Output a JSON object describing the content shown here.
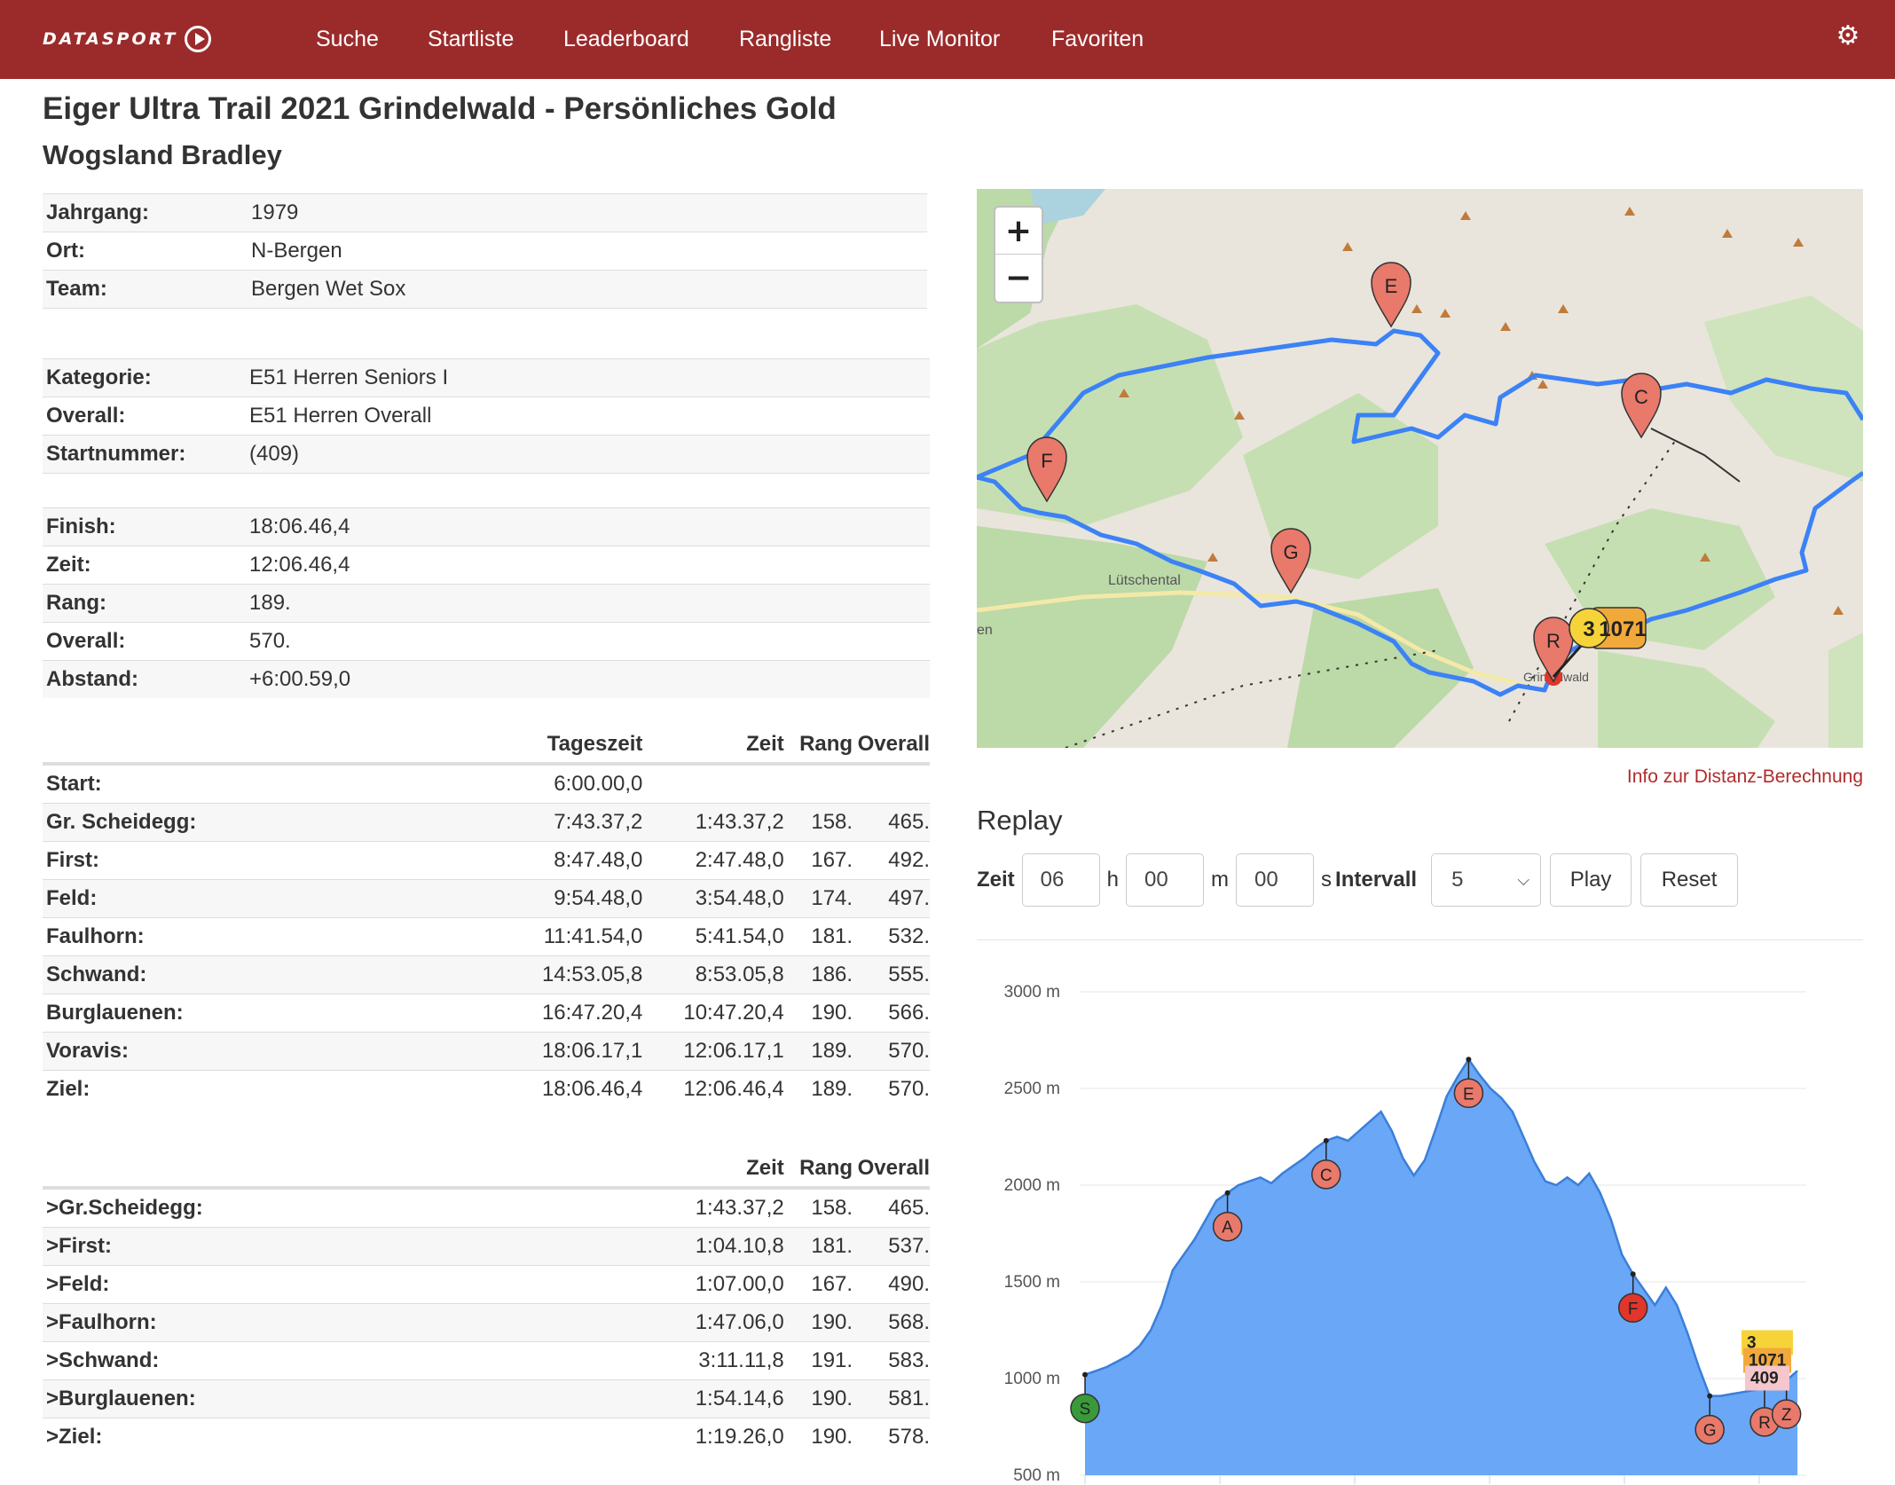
{
  "nav": {
    "brand": "DATASPORT",
    "items": [
      "Suche",
      "Startliste",
      "Leaderboard",
      "Rangliste",
      "Live Monitor",
      "Favoriten"
    ],
    "settings_icon": "gear-icon"
  },
  "title": "Eiger Ultra Trail 2021 Grindelwald - Persönliches Gold",
  "athlete": "Wogsland Bradley",
  "personal": [
    {
      "k": "Jahrgang:",
      "v": "1979"
    },
    {
      "k": "Ort:",
      "v": "N-Bergen"
    },
    {
      "k": "Team:",
      "v": "Bergen Wet Sox"
    }
  ],
  "category": [
    {
      "k": "Kategorie:",
      "v": "E51 Herren Seniors I"
    },
    {
      "k": "Overall:",
      "v": "E51 Herren Overall"
    },
    {
      "k": "Startnummer:",
      "v": "(409)"
    }
  ],
  "result": [
    {
      "k": "Finish:",
      "v": "18:06.46,4"
    },
    {
      "k": "Zeit:",
      "v": "12:06.46,4"
    },
    {
      "k": "Rang:",
      "v": "189."
    },
    {
      "k": "Overall:",
      "v": "570."
    },
    {
      "k": "Abstand:",
      "v": "+6:00.59,0"
    }
  ],
  "splits": {
    "headers": {
      "tageszeit": "Tageszeit",
      "zeit": "Zeit",
      "rang": "Rang",
      "overall": "Overall"
    },
    "rows": [
      {
        "name": "Start:",
        "tag": "6:00.00,0",
        "zeit": "",
        "rang": "",
        "overall": ""
      },
      {
        "name": "Gr. Scheidegg:",
        "tag": "7:43.37,2",
        "zeit": "1:43.37,2",
        "rang": "158.",
        "overall": "465."
      },
      {
        "name": "First:",
        "tag": "8:47.48,0",
        "zeit": "2:47.48,0",
        "rang": "167.",
        "overall": "492."
      },
      {
        "name": "Feld:",
        "tag": "9:54.48,0",
        "zeit": "3:54.48,0",
        "rang": "174.",
        "overall": "497."
      },
      {
        "name": "Faulhorn:",
        "tag": "11:41.54,0",
        "zeit": "5:41.54,0",
        "rang": "181.",
        "overall": "532."
      },
      {
        "name": "Schwand:",
        "tag": "14:53.05,8",
        "zeit": "8:53.05,8",
        "rang": "186.",
        "overall": "555."
      },
      {
        "name": "Burglauenen:",
        "tag": "16:47.20,4",
        "zeit": "10:47.20,4",
        "rang": "190.",
        "overall": "566."
      },
      {
        "name": "Voravis:",
        "tag": "18:06.17,1",
        "zeit": "12:06.17,1",
        "rang": "189.",
        "overall": "570."
      },
      {
        "name": "Ziel:",
        "tag": "18:06.46,4",
        "zeit": "12:06.46,4",
        "rang": "189.",
        "overall": "570."
      }
    ]
  },
  "segments": {
    "headers": {
      "zeit": "Zeit",
      "rang": "Rang",
      "overall": "Overall"
    },
    "rows": [
      {
        "name": ">Gr.Scheidegg:",
        "zeit": "1:43.37,2",
        "rang": "158.",
        "overall": "465."
      },
      {
        "name": ">First:",
        "zeit": "1:04.10,8",
        "rang": "181.",
        "overall": "537."
      },
      {
        "name": ">Feld:",
        "zeit": "1:07.00,0",
        "rang": "167.",
        "overall": "490."
      },
      {
        "name": ">Faulhorn:",
        "zeit": "1:47.06,0",
        "rang": "190.",
        "overall": "568."
      },
      {
        "name": ">Schwand:",
        "zeit": "3:11.11,8",
        "rang": "191.",
        "overall": "583."
      },
      {
        "name": ">Burglauenen:",
        "zeit": "1:54.14,6",
        "rang": "190.",
        "overall": "581."
      },
      {
        "name": ">Ziel:",
        "zeit": "1:19.26,0",
        "rang": "190.",
        "overall": "578."
      }
    ]
  },
  "map": {
    "zoom_in": "+",
    "zoom_out": "−",
    "place_labels": [
      "Lütschental",
      "Grindelwald",
      "en"
    ],
    "markers": [
      "E",
      "C",
      "F",
      "G",
      "R"
    ],
    "cluster_labels": [
      "3",
      "1071"
    ],
    "route_color": "#3b82f6",
    "marker_color": "#e8796b"
  },
  "info_link": "Info zur Distanz-Berechnung",
  "replay": {
    "title": "Replay",
    "zeit_label": "Zeit",
    "hours": "06",
    "h_unit": "h",
    "minutes": "00",
    "m_unit": "m",
    "seconds": "00",
    "s_unit": "s",
    "intervall_label": "Intervall",
    "intervall": "5",
    "play": "Play",
    "reset": "Reset"
  },
  "chart_data": {
    "type": "area",
    "title": "",
    "xlabel": "",
    "ylabel": "",
    "y_ticks": [
      "3000 m",
      "2500 m",
      "2000 m",
      "1500 m",
      "1000 m",
      "500 m"
    ],
    "ylim": [
      500,
      3000
    ],
    "fill_color": "#6aa7f7",
    "line_color": "#3a7fd9",
    "series": [
      {
        "values": [
          1020,
          1040,
          1060,
          1090,
          1120,
          1170,
          1250,
          1380,
          1560,
          1640,
          1720,
          1820,
          1920,
          1960,
          2000,
          2020,
          2040,
          2010,
          2060,
          2100,
          2140,
          2190,
          2230,
          2250,
          2230,
          2280,
          2330,
          2380,
          2280,
          2140,
          2050,
          2130,
          2290,
          2460,
          2560,
          2650,
          2570,
          2500,
          2450,
          2380,
          2250,
          2120,
          2020,
          2000,
          2040,
          2000,
          2060,
          1960,
          1820,
          1640,
          1540,
          1460,
          1380,
          1470,
          1380,
          1230,
          1060,
          910,
          910,
          920,
          930,
          940,
          950,
          960,
          990,
          1040
        ]
      }
    ],
    "markers": [
      {
        "label": "S",
        "x_index": 0,
        "color": "#3a9a3a"
      },
      {
        "label": "A",
        "x_index": 13,
        "color": "#e8796b"
      },
      {
        "label": "C",
        "x_index": 22,
        "color": "#e8796b"
      },
      {
        "label": "E",
        "x_index": 35,
        "color": "#e8796b"
      },
      {
        "label": "F",
        "x_index": 50,
        "color": "#e0362c"
      },
      {
        "label": "G",
        "x_index": 57,
        "color": "#e8796b"
      },
      {
        "label": "R",
        "x_index": 62,
        "color": "#e8796b"
      },
      {
        "label": "Z",
        "x_index": 64,
        "color": "#e8796b"
      }
    ],
    "tags": [
      "3",
      "1071",
      "409"
    ]
  }
}
